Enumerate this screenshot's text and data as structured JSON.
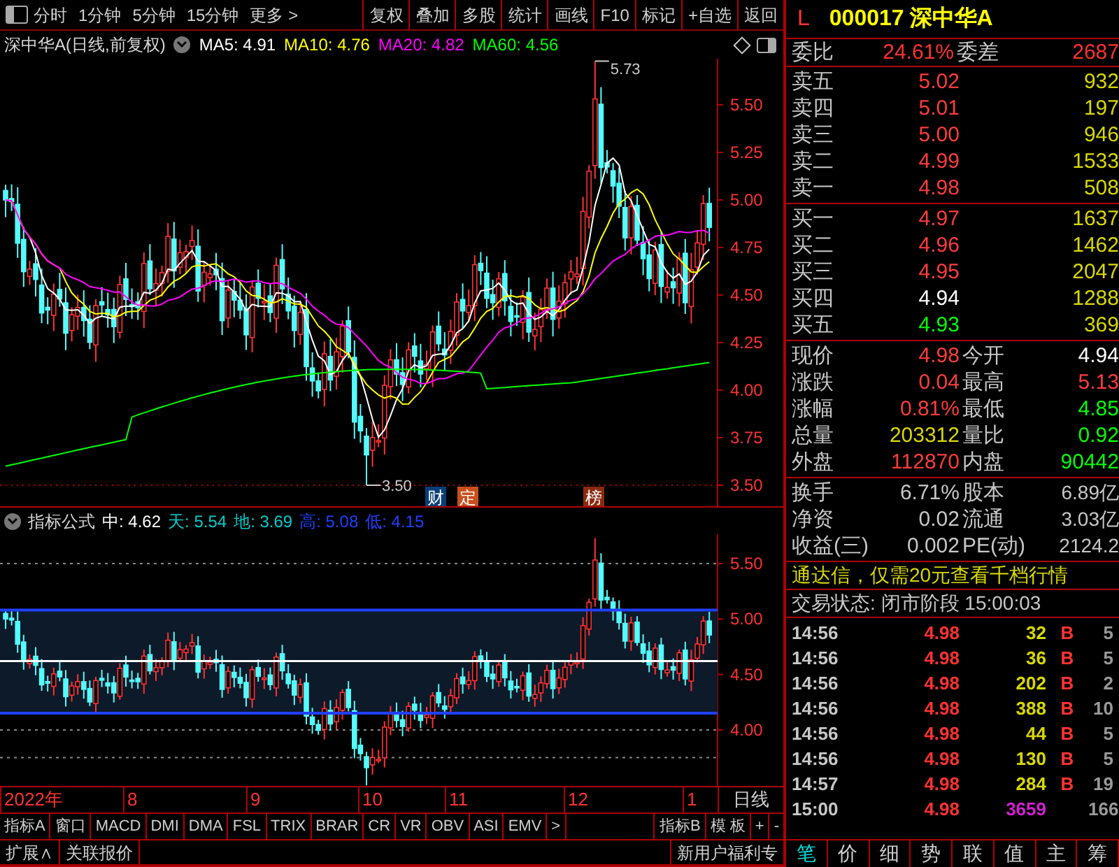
{
  "toolbar": {
    "periods": [
      "分时",
      "1分钟",
      "5分钟",
      "15分钟",
      "更多 >"
    ],
    "buttons": [
      "复权",
      "叠加",
      "多股",
      "统计",
      "画线",
      "F10",
      "标记",
      "+自选",
      "返回"
    ]
  },
  "chart": {
    "title": "深中华A(日线,前复权)",
    "ma": [
      {
        "label": "MA5: 4.91",
        "color": "#ffffff"
      },
      {
        "label": "MA10: 4.76",
        "color": "#ffff00"
      },
      {
        "label": "MA20: 4.82",
        "color": "#ff00ff"
      },
      {
        "label": "MA60: 4.56",
        "color": "#00ff00"
      }
    ],
    "high_marker": "5.73",
    "low_marker": "3.50",
    "price_labels": [
      "5.50",
      "5.25",
      "5.00",
      "4.75",
      "4.50",
      "4.25",
      "4.00",
      "3.75",
      "3.50"
    ],
    "events": [
      {
        "text": "财",
        "color": "#0a3d7a"
      },
      {
        "text": "定",
        "color": "#c8501e"
      },
      {
        "text": "榜",
        "color": "#8a2a10"
      }
    ]
  },
  "indicator": {
    "name": "指标公式",
    "values": [
      {
        "label": "中: 4.62",
        "color": "#ffffff"
      },
      {
        "label": "天: 5.54",
        "color": "#00cccc"
      },
      {
        "label": "地: 3.69",
        "color": "#00cccc"
      },
      {
        "label": "高: 5.08",
        "color": "#2040ff"
      },
      {
        "label": "低: 4.15",
        "color": "#2040ff"
      }
    ],
    "price_labels": [
      "5.50",
      "5.00",
      "4.50",
      "4.00"
    ]
  },
  "time_axis": {
    "labels": [
      "2022年",
      "8",
      "9",
      "10",
      "11",
      "12",
      "1"
    ],
    "period": "日线"
  },
  "indicator_tabs": {
    "left": [
      "指标A",
      "窗口",
      "MACD",
      "DMI",
      "DMA",
      "FSL",
      "TRIX",
      "BRAR",
      "CR",
      "VR",
      "OBV",
      "ASI",
      "EMV",
      ">"
    ],
    "right": [
      "指标B",
      "模 板",
      "+",
      "-"
    ]
  },
  "bottom_bar": {
    "left": [
      "扩展∧",
      "关联报价"
    ],
    "right": "新用户福利专"
  },
  "quote": {
    "marker": "L",
    "code": "000017",
    "name": "深中华A",
    "ratio": {
      "label": "委比",
      "value": "24.61%",
      "label_2": "委差",
      "value_2": "2687"
    },
    "asks": [
      {
        "label": "卖五",
        "price": "5.02",
        "volume": "932",
        "color": "#ff3c3c"
      },
      {
        "label": "卖四",
        "price": "5.01",
        "volume": "197",
        "color": "#ff3c3c"
      },
      {
        "label": "卖三",
        "price": "5.00",
        "volume": "946",
        "color": "#ff3c3c"
      },
      {
        "label": "卖二",
        "price": "4.99",
        "volume": "1533",
        "color": "#ff3c3c"
      },
      {
        "label": "卖一",
        "price": "4.98",
        "volume": "508",
        "color": "#ff3c3c"
      }
    ],
    "bids": [
      {
        "label": "买一",
        "price": "4.97",
        "volume": "1637",
        "color": "#ff3c3c"
      },
      {
        "label": "买二",
        "price": "4.96",
        "volume": "1462",
        "color": "#ff3c3c"
      },
      {
        "label": "买三",
        "price": "4.95",
        "volume": "2047",
        "color": "#ff3c3c"
      },
      {
        "label": "买四",
        "price": "4.94",
        "volume": "1288",
        "color": "#ffffff"
      },
      {
        "label": "买五",
        "price": "4.93",
        "volume": "369",
        "color": "#00ff00"
      }
    ],
    "stats": [
      [
        {
          "label": "现价",
          "value": "4.98",
          "color": "#ff3c3c"
        },
        {
          "label": "今开",
          "value": "4.94",
          "color": "#ffffff"
        }
      ],
      [
        {
          "label": "涨跌",
          "value": "0.04",
          "color": "#ff3c3c"
        },
        {
          "label": "最高",
          "value": "5.13",
          "color": "#ff3c3c"
        }
      ],
      [
        {
          "label": "涨幅",
          "value": "0.81%",
          "color": "#ff3c3c"
        },
        {
          "label": "最低",
          "value": "4.85",
          "color": "#00ff00"
        }
      ],
      [
        {
          "label": "总量",
          "value": "203312",
          "color": "#d8d800"
        },
        {
          "label": "量比",
          "value": "0.92",
          "color": "#00ff00"
        }
      ],
      [
        {
          "label": "外盘",
          "value": "112870",
          "color": "#ff3c3c"
        },
        {
          "label": "内盘",
          "value": "90442",
          "color": "#00ff00"
        }
      ]
    ],
    "fundamentals": [
      {
        "label": "换手",
        "value": "6.71%",
        "label_2": "股本",
        "value_2": "6.89亿"
      },
      {
        "label": "净资",
        "value": "0.02",
        "label_2": "流通",
        "value_2": "3.03亿"
      },
      {
        "label": "收益(三)",
        "value": "0.002",
        "label_2": "PE(动)",
        "value_2": "2124.2"
      }
    ],
    "banner": "通达信，仅需20元查看千档行情",
    "status": "交易状态: 闭市阶段 15:00:03",
    "ticks": [
      {
        "time": "14:56",
        "price": "4.98",
        "volume": "32",
        "side": "B",
        "column_5": "5",
        "kind": "normal"
      },
      {
        "time": "14:56",
        "price": "4.98",
        "volume": "36",
        "side": "B",
        "column_5": "5",
        "kind": "normal"
      },
      {
        "time": "14:56",
        "price": "4.98",
        "volume": "202",
        "side": "B",
        "column_5": "2",
        "kind": "normal"
      },
      {
        "time": "14:56",
        "price": "4.98",
        "volume": "388",
        "side": "B",
        "column_5": "10",
        "kind": "normal"
      },
      {
        "time": "14:56",
        "price": "4.98",
        "volume": "44",
        "side": "B",
        "column_5": "5",
        "kind": "normal"
      },
      {
        "time": "14:56",
        "price": "4.98",
        "volume": "130",
        "side": "B",
        "column_5": "5",
        "kind": "normal"
      },
      {
        "time": "14:57",
        "price": "4.98",
        "volume": "284",
        "side": "B",
        "column_5": "19",
        "kind": "normal"
      },
      {
        "time": "15:00",
        "price": "4.98",
        "volume": "3659",
        "column_5": "166",
        "kind": "close"
      }
    ],
    "tabs": [
      {
        "label": "笔",
        "selected": true
      },
      {
        "label": "价",
        "selected": false
      },
      {
        "label": "细",
        "selected": false
      },
      {
        "label": "势",
        "selected": false
      },
      {
        "label": "联",
        "selected": false
      },
      {
        "label": "值",
        "selected": false
      },
      {
        "label": "主",
        "selected": false
      },
      {
        "label": "筹",
        "selected": false
      }
    ]
  }
}
